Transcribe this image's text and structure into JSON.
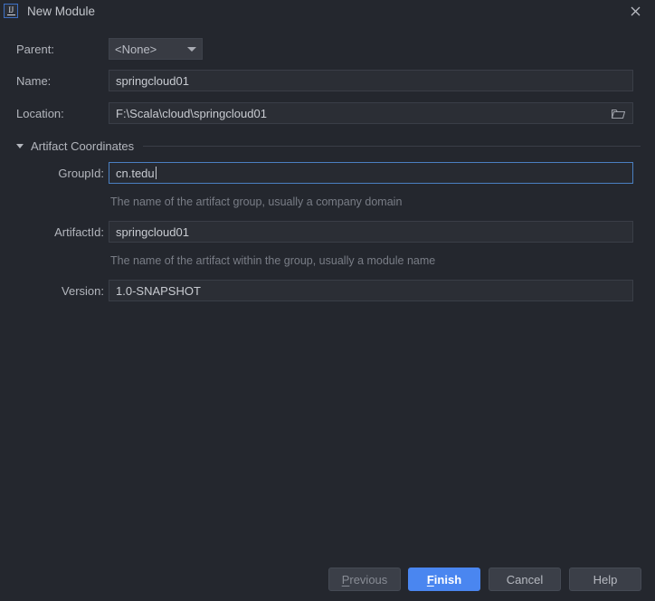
{
  "window": {
    "title": "New Module",
    "logo_icon": "intellij-idea-logo-icon",
    "close_icon": "close-icon"
  },
  "form": {
    "parent": {
      "label": "Parent:",
      "value": "<None>",
      "dropdown_icon": "chevron-down-icon"
    },
    "name": {
      "label": "Name:",
      "value": "springcloud01"
    },
    "location": {
      "label": "Location:",
      "value": "F:\\Scala\\cloud\\springcloud01",
      "browse_icon": "folder-icon"
    }
  },
  "artifact_section": {
    "label": "Artifact Coordinates",
    "expanded": true,
    "toggle_icon": "triangle-down-icon",
    "fields": {
      "group_id": {
        "label": "GroupId:",
        "value": "cn.tedu",
        "focused": true,
        "hint": "The name of the artifact group, usually a company domain"
      },
      "artifact_id": {
        "label": "ArtifactId:",
        "value": "springcloud01",
        "focused": false,
        "hint": "The name of the artifact within the group, usually a module name"
      },
      "version": {
        "label": "Version:",
        "value": "1.0-SNAPSHOT",
        "focused": false
      }
    }
  },
  "buttons": {
    "previous": {
      "label": "Previous",
      "mnemonic": "P"
    },
    "finish": {
      "label": "Finish",
      "mnemonic": "F",
      "primary": true
    },
    "cancel": {
      "label": "Cancel"
    },
    "help": {
      "label": "Help"
    }
  },
  "colors": {
    "background": "#24272e",
    "field_background": "#2b2e35",
    "accent": "#4a86f0",
    "focus_border": "#4a7fc1",
    "text": "#b9bcc4",
    "hint_text": "#797d86"
  }
}
